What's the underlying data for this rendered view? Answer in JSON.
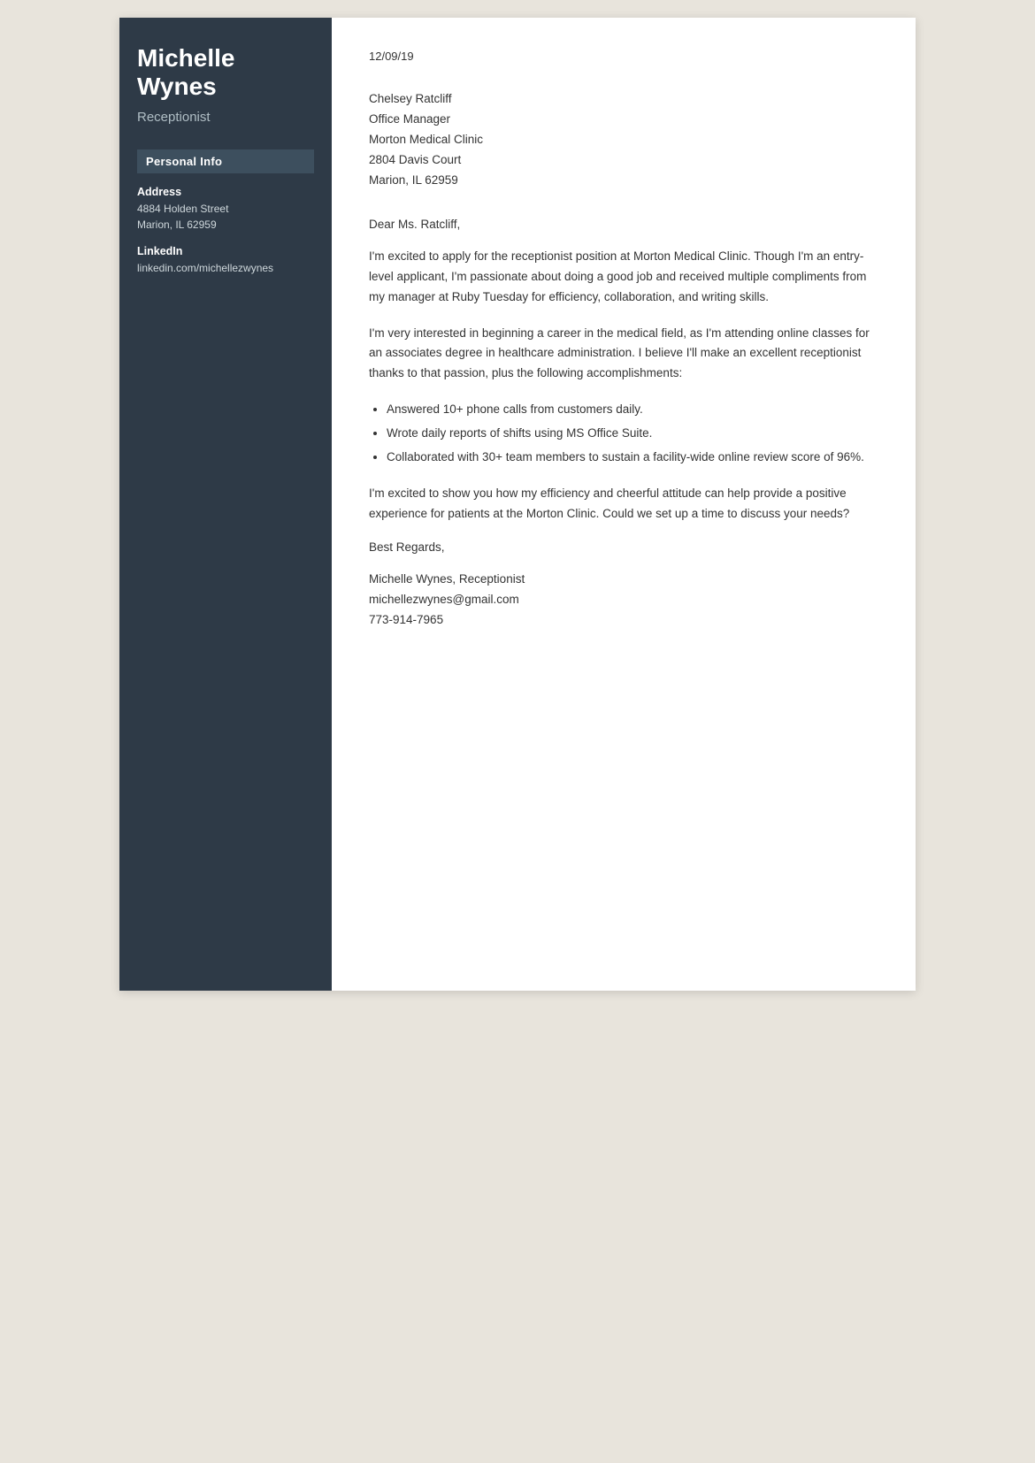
{
  "sidebar": {
    "name": "Michelle\nWynes",
    "name_line1": "Michelle",
    "name_line2": "Wynes",
    "title": "Receptionist",
    "personal_info_header": "Personal Info",
    "address_label": "Address",
    "address_line1": "4884 Holden Street",
    "address_line2": "Marion, IL 62959",
    "linkedin_label": "LinkedIn",
    "linkedin_value": "linkedin.com/michellezwynes"
  },
  "letter": {
    "date": "12/09/19",
    "recipient_name": "Chelsey Ratcliff",
    "recipient_title": "Office Manager",
    "recipient_company": "Morton Medical Clinic",
    "recipient_address1": "2804 Davis Court",
    "recipient_address2": "Marion, IL 62959",
    "salutation": "Dear Ms. Ratcliff,",
    "paragraph1": "I'm excited to apply for the receptionist position at Morton Medical Clinic. Though I'm an entry-level applicant, I'm passionate about doing a good job and received multiple compliments from my manager at Ruby Tuesday for efficiency, collaboration, and writing skills.",
    "paragraph2": "I'm very interested in beginning a career in the medical field, as I'm attending online classes for an associates degree in healthcare administration. I believe I'll make an excellent receptionist thanks to that passion, plus the following accomplishments:",
    "bullets": [
      "Answered 10+ phone calls from customers daily.",
      "Wrote daily reports of shifts using MS Office Suite.",
      "Collaborated with 30+ team members to sustain a facility-wide online review score of 96%."
    ],
    "paragraph3": "I'm excited to show you how my efficiency and cheerful attitude can help provide a positive experience for patients at the Morton Clinic. Could we set up a time to discuss your needs?",
    "closing": "Best Regards,",
    "signature_name": "Michelle Wynes, Receptionist",
    "signature_email": "michellezwynes@gmail.com",
    "signature_phone": "773-914-7965"
  }
}
